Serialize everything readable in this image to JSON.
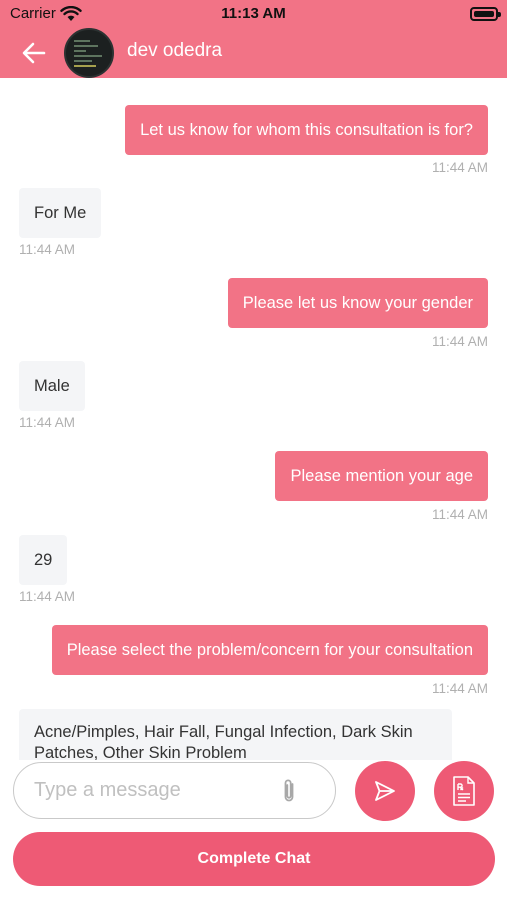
{
  "status_bar": {
    "carrier": "Carrier",
    "time": "11:13 AM"
  },
  "header": {
    "contact_name": "dev odedra",
    "back_icon": "arrow-left-icon",
    "background_color": "#f27386"
  },
  "messages": [
    {
      "direction": "outgoing",
      "text": "Let us know for whom this consultation is for?",
      "time": "11:44 AM"
    },
    {
      "direction": "incoming",
      "text": "For Me",
      "time": "11:44 AM"
    },
    {
      "direction": "outgoing",
      "text": "Please let us know your gender",
      "time": "11:44 AM"
    },
    {
      "direction": "incoming",
      "text": "Male",
      "time": "11:44 AM"
    },
    {
      "direction": "outgoing",
      "text": "Please mention your age",
      "time": "11:44 AM"
    },
    {
      "direction": "incoming",
      "text": "29",
      "time": "11:44 AM"
    },
    {
      "direction": "outgoing",
      "text": "Please select the problem/concern for your consultation",
      "time": "11:44 AM"
    },
    {
      "direction": "incoming",
      "text": "Acne/Pimples,  Hair Fall,  Fungal Infection,  Dark Skin Patches,  Other Skin Problem"
    }
  ],
  "composer": {
    "placeholder": "Type a message",
    "value": "",
    "attach_icon": "paperclip-icon",
    "send_icon": "send-icon",
    "prescription_icon": "prescription-icon"
  },
  "footer": {
    "complete_label": "Complete Chat"
  },
  "colors": {
    "accent": "#f27386",
    "button": "#ee5a75",
    "incoming_bubble": "#f4f5f7",
    "timestamp": "#b0b0b0"
  }
}
